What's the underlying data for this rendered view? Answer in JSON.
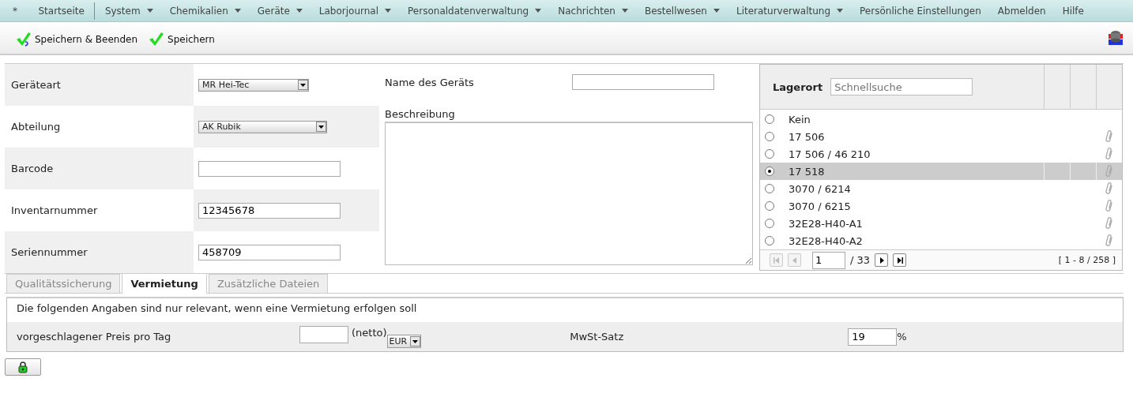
{
  "menu": [
    {
      "label": "*",
      "dropdown": false
    },
    {
      "label": "Startseite",
      "dropdown": false
    },
    {
      "label": "System",
      "dropdown": true
    },
    {
      "label": "Chemikalien",
      "dropdown": true
    },
    {
      "label": "Geräte",
      "dropdown": true
    },
    {
      "label": "Laborjournal",
      "dropdown": true
    },
    {
      "label": "Personaldatenverwaltung",
      "dropdown": true
    },
    {
      "label": "Nachrichten",
      "dropdown": true
    },
    {
      "label": "Bestellwesen",
      "dropdown": true
    },
    {
      "label": "Literaturverwaltung",
      "dropdown": true
    },
    {
      "label": "Persönliche Einstellungen",
      "dropdown": false
    },
    {
      "label": "Abmelden",
      "dropdown": false
    },
    {
      "label": "Hilfe",
      "dropdown": false
    }
  ],
  "toolbar": {
    "buttons": [
      {
        "label": "Speichern & Beenden",
        "kind": "save-close"
      },
      {
        "label": "Speichern",
        "kind": "save"
      }
    ]
  },
  "form": {
    "fields": [
      {
        "label": "Geräteart",
        "kind": "select",
        "value": "MR Hei-Tec"
      },
      {
        "label": "Abteilung",
        "kind": "select",
        "value": "AK Rubik"
      },
      {
        "label": "Barcode",
        "kind": "text"
      },
      {
        "label": "Inventarnummer",
        "kind": "text",
        "value": "12345678"
      },
      {
        "label": "Seriennummer",
        "kind": "text",
        "value": "458709"
      }
    ],
    "name_field": {
      "label": "Name des Geräts"
    },
    "description": {
      "label": "Beschreibung"
    }
  },
  "location_grid": {
    "title": "Lagerort",
    "search_placeholder": "Schnellsuche",
    "rows": [
      {
        "label": "Kein",
        "selected": false,
        "attachment": false
      },
      {
        "label": "17 506",
        "selected": false,
        "attachment": true
      },
      {
        "label": "17 506 / 46 210",
        "selected": false,
        "attachment": true
      },
      {
        "label": "17 518",
        "selected": true,
        "attachment": true
      },
      {
        "label": "3070 / 6214",
        "selected": false,
        "attachment": true
      },
      {
        "label": "3070 / 6215",
        "selected": false,
        "attachment": true
      },
      {
        "label": "32E28-H40-A1",
        "selected": false,
        "attachment": true
      },
      {
        "label": "32E28-H40-A2",
        "selected": false,
        "attachment": true
      }
    ],
    "pager": {
      "page": "1",
      "total": "/ 33",
      "range": "[ 1 - 8 / 258 ]",
      "first_disabled": true,
      "prev_disabled": true,
      "next_disabled": false,
      "last_disabled": false
    }
  },
  "tabs": [
    {
      "label": "Qualitätssicherung",
      "selected": false
    },
    {
      "label": "Vermietung",
      "selected": true
    },
    {
      "label": "Zusätzliche Dateien",
      "selected": false
    }
  ],
  "rental": {
    "note": "Die folgenden Angaben sind nur relevant, wenn eine Vermietung erfolgen soll",
    "price_label": "vorgeschlagener Preis pro Tag",
    "netto": "(netto)",
    "currency": "EUR",
    "vat_label": "MwSt-Satz",
    "vat_value": "19",
    "percent": "%"
  }
}
